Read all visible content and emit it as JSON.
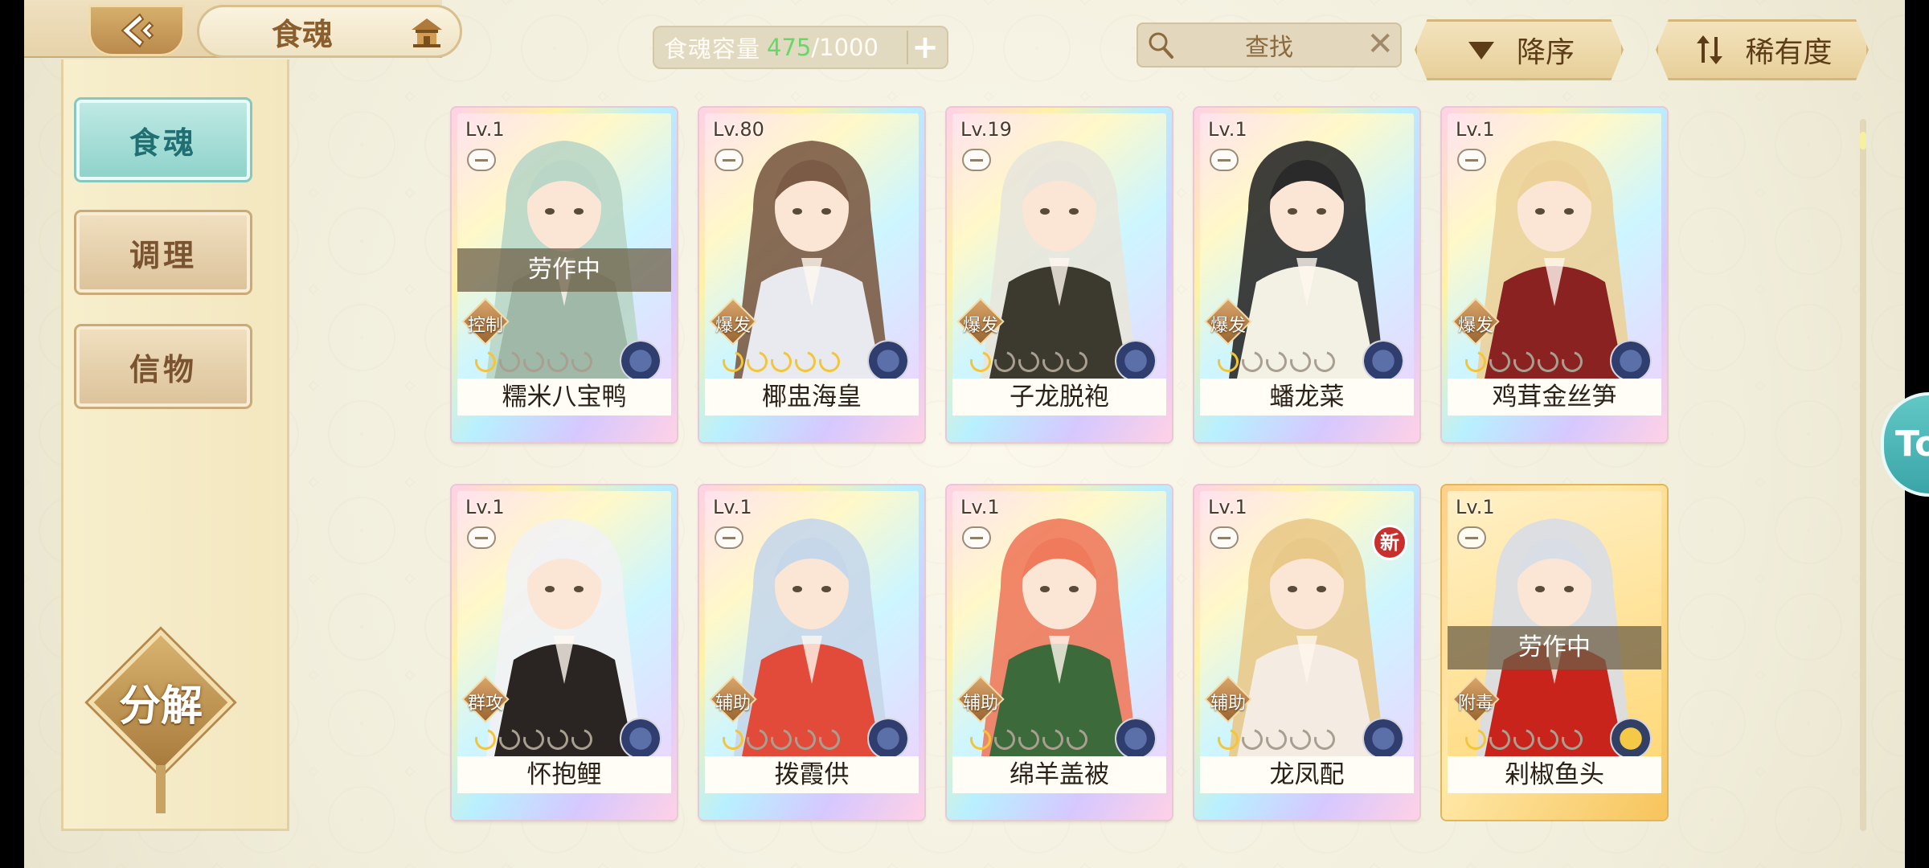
{
  "header": {
    "title": "食魂",
    "capacity_label": "食魂容量",
    "capacity_current": "475",
    "capacity_max": "/1000",
    "plus_label": "+",
    "search_text": "查找",
    "search_clear": "✕",
    "sort_order_label": "降序",
    "sort_key_label": "稀有度"
  },
  "sidebar": {
    "items": [
      {
        "label": "食魂",
        "active": true
      },
      {
        "label": "调理",
        "active": false
      },
      {
        "label": "信物",
        "active": false
      }
    ],
    "decompose_label": "分解"
  },
  "side_tab_label": "To",
  "cards": [
    {
      "level": "Lv.1",
      "name": "糯米八宝鸭",
      "role": "控制",
      "stars": 1,
      "busy": "劳作中",
      "hair": "#b9d6c6",
      "coat": "#9fb8a8"
    },
    {
      "level": "Lv.80",
      "name": "椰盅海皇",
      "role": "爆发",
      "stars": 5,
      "busy": "",
      "hair": "#7b5b45",
      "coat": "#e9e9f0"
    },
    {
      "level": "Lv.19",
      "name": "子龙脱袍",
      "role": "爆发",
      "stars": 1,
      "busy": "",
      "hair": "#e8e6dc",
      "coat": "#3c3a2e"
    },
    {
      "level": "Lv.1",
      "name": "蟠龙菜",
      "role": "爆发",
      "stars": 1,
      "busy": "",
      "hair": "#2a2a2a",
      "coat": "#f3f0e4"
    },
    {
      "level": "Lv.1",
      "name": "鸡茸金丝笋",
      "role": "爆发",
      "stars": 1,
      "busy": "",
      "hair": "#ecd29a",
      "coat": "#8a2222"
    },
    {
      "level": "Lv.1",
      "name": "怀抱鲤",
      "role": "群攻",
      "stars": 1,
      "busy": "",
      "hair": "#f2f2f4",
      "coat": "#2a2522"
    },
    {
      "level": "Lv.1",
      "name": "拨霞供",
      "role": "辅助",
      "stars": 1,
      "busy": "",
      "hair": "#c6d7ea",
      "coat": "#e24a3a"
    },
    {
      "level": "Lv.1",
      "name": "绵羊盖被",
      "role": "辅助",
      "stars": 1,
      "busy": "",
      "hair": "#f07a5c",
      "coat": "#3d6a3a"
    },
    {
      "level": "Lv.1",
      "name": "龙凤配",
      "role": "辅助",
      "stars": 1,
      "busy": "",
      "hair": "#e9c98a",
      "coat": "#f4ece2",
      "new": "新"
    },
    {
      "level": "Lv.1",
      "name": "剁椒鱼头",
      "role": "附毒",
      "stars": 1,
      "busy": "劳作中",
      "hair": "#d9dde6",
      "coat": "#c8241c",
      "gold": true
    }
  ],
  "colors": {
    "accent_teal": "#8fd3cb",
    "gold": "#d4b77a",
    "capacity_green": "#66d86a",
    "star_on": "#f3c63a",
    "new_badge": "#c8302e"
  }
}
